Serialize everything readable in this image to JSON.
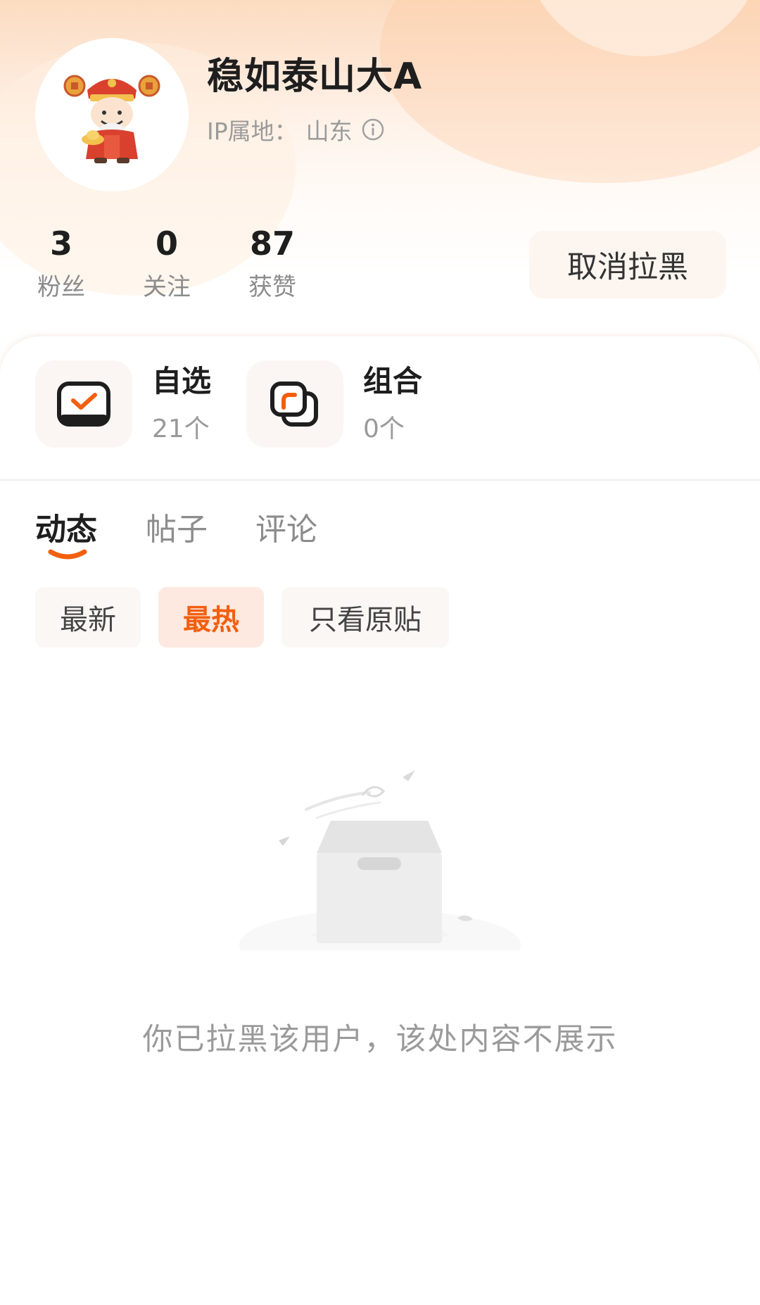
{
  "profile": {
    "name": "稳如泰山大A",
    "ip_label": "IP属地：",
    "ip_location": "山东"
  },
  "stats": [
    {
      "value": "3",
      "label": "粉丝"
    },
    {
      "value": "0",
      "label": "关注"
    },
    {
      "value": "87",
      "label": "获赞"
    }
  ],
  "actions": {
    "unblock_label": "取消拉黑"
  },
  "favorites": [
    {
      "title": "自选",
      "count": "21个",
      "icon": "checkbox-icon"
    },
    {
      "title": "组合",
      "count": "0个",
      "icon": "portfolio-icon"
    }
  ],
  "tabs": [
    {
      "label": "动态",
      "active": true
    },
    {
      "label": "帖子",
      "active": false
    },
    {
      "label": "评论",
      "active": false
    }
  ],
  "filters": [
    {
      "label": "最新",
      "active": false
    },
    {
      "label": "最热",
      "active": true
    },
    {
      "label": "只看原贴",
      "active": false
    }
  ],
  "empty_state": {
    "message": "你已拉黑该用户，该处内容不展示",
    "icon": "empty-box-icon"
  },
  "colors": {
    "accent": "#f25f0f",
    "header_gradient_top": "#fcdcc0"
  }
}
